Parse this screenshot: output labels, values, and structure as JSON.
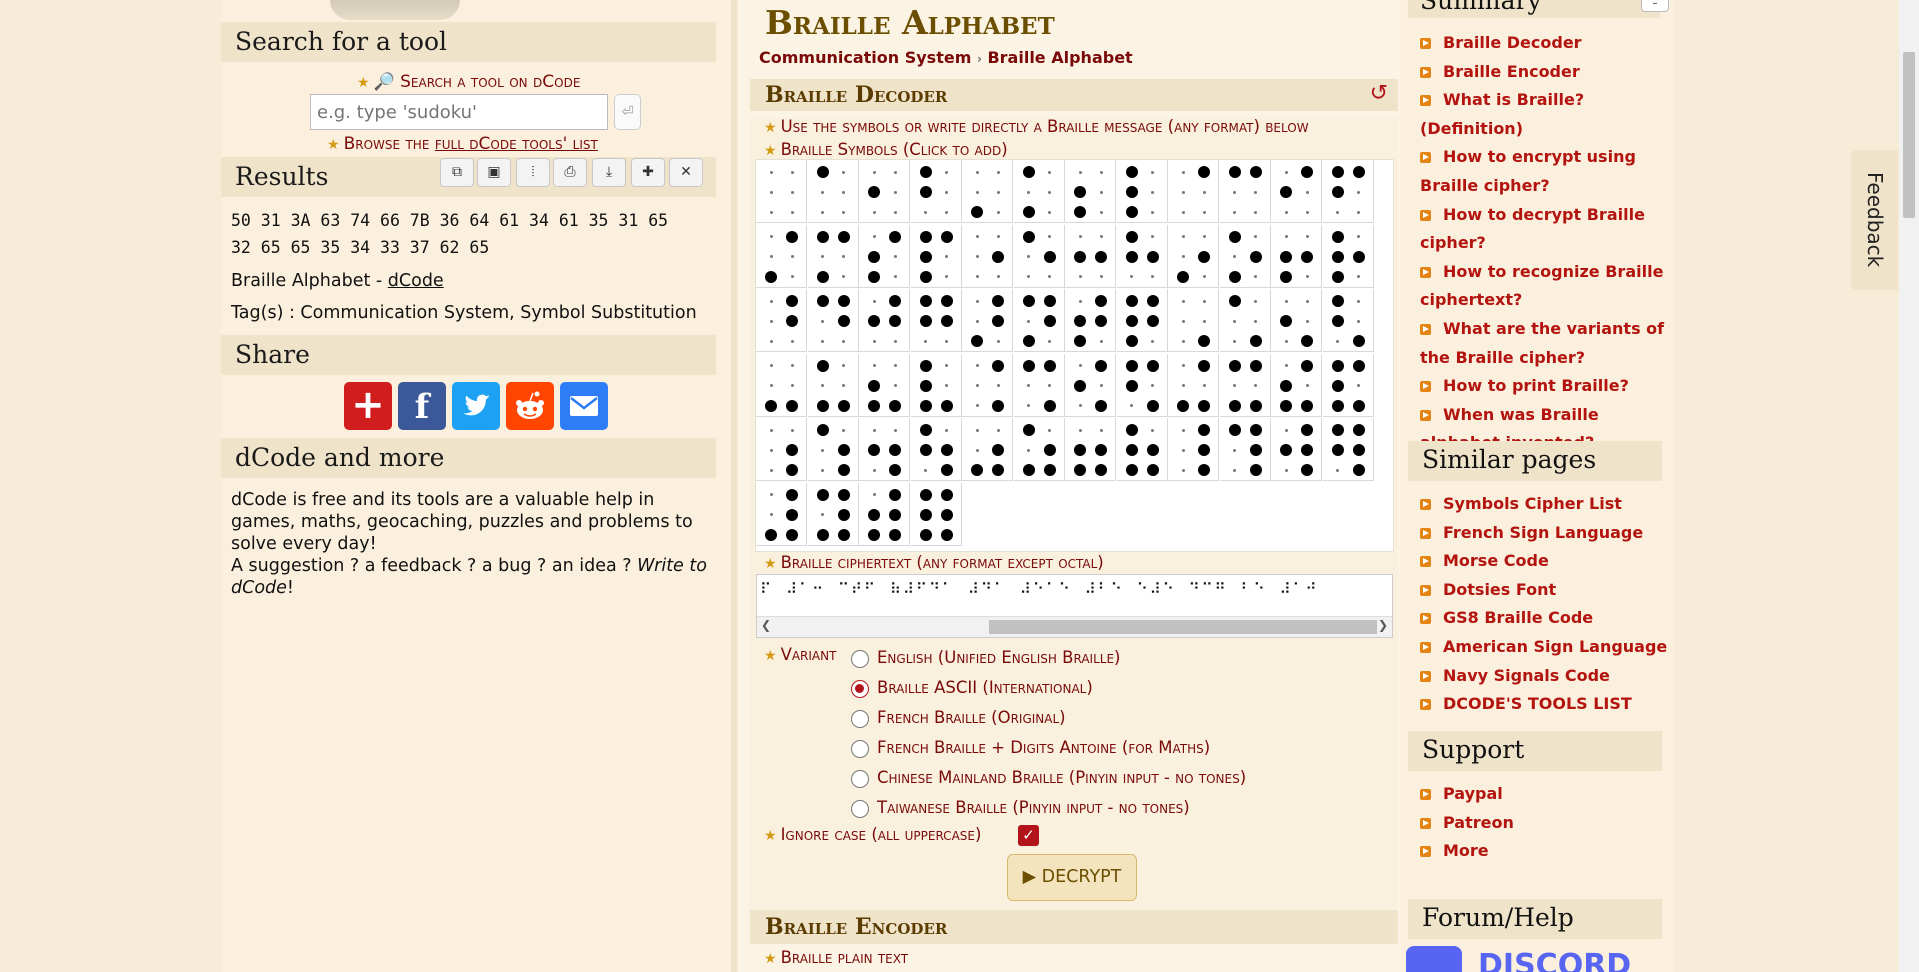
{
  "left": {
    "search_heading": "Search for a tool",
    "search_link": "Search a tool on dCode",
    "search_placeholder": "e.g. type 'sudoku'",
    "browse_prefix": "Browse the ",
    "browse_link": "full dCode tools' list",
    "results_heading": "Results",
    "results_line1": "50 31 3A 63 74 66 7B 36 64 61 34 61 35 31 65",
    "results_line2": "32 65 65 35 34 33 37 62 65",
    "page_ref": "Braille Alphabet - ",
    "page_ref_link": "dCode",
    "tags": "Tag(s) : Communication System, Symbol Substitution",
    "share_heading": "Share",
    "more_heading": "dCode and more",
    "more_text": "dCode is free and its tools are a valuable help in games, maths, geocaching, puzzles and problems to solve every day!",
    "more_text2": "A suggestion ? a feedback ? a bug ? an idea ? ",
    "more_text2_em": "Write to dCode",
    "more_text2_end": "!"
  },
  "main": {
    "title": "Braille Alphabet",
    "breadcrumb": [
      "Communication System",
      "Braille Alphabet"
    ],
    "decoder_heading": "Braille Decoder",
    "instruction": "Use the symbols or write directly a Braille message (any format) below",
    "symbols_label": "Braille Symbols (Click to add)",
    "ciphertext_label": "Braille ciphertext (any format except octal)",
    "ciphertext_value": "⠏⠀⠼⠁⠒⠀⠉⠞⠋⠀⠷⠼⠋⠙⠁⠀⠼⠙⠁⠀⠼⠑⠁⠑⠀⠼⠃⠑⠀⠑⠼⠑⠀⠙⠉⠛⠀⠃⠑⠀⠼⠁⠚",
    "variant_label": "Variant",
    "variants": [
      "English (Unified English Braille)",
      "Braille ASCII (International)",
      "French Braille (Original)",
      "French Braille + Digits Antoine (for Maths)",
      "Chinese Mainland Braille (Pinyin input - no tones)",
      "Taiwanese Braille (Pinyin input - no tones)"
    ],
    "selected_variant": 1,
    "ignore_case_label": "Ignore case (all uppercase)",
    "ignore_case_checked": true,
    "decrypt_label": "▶ DECRYPT",
    "encoder_heading": "Braille Encoder",
    "plain_label": "Braille plain text"
  },
  "right": {
    "summary_heading": "Summary",
    "summary_items": [
      "Braille Decoder",
      "Braille Encoder",
      "What is Braille? (Definition)",
      "How to encrypt using Braille cipher?",
      "How to decrypt Braille cipher?",
      "How to recognize Braille ciphertext?",
      "What are the variants of the Braille cipher?",
      "How to print Braille?",
      "When was Braille alphabet invented?"
    ],
    "similar_heading": "Similar pages",
    "similar_items": [
      "Symbols Cipher List",
      "French Sign Language",
      "Morse Code",
      "Dotsies Font",
      "GS8 Braille Code",
      "American Sign Language",
      "Navy Signals Code",
      "DCODE'S TOOLS LIST"
    ],
    "support_heading": "Support",
    "support_items": [
      "Paypal",
      "Patreon",
      "More"
    ],
    "forum_heading": "Forum/Help",
    "discord_text": "DISCORD"
  },
  "feedback_tab": "Feedback",
  "colors": {
    "accent_red": "#7a0a0a",
    "link_red": "#b4140f",
    "title_gold": "#6b4e00",
    "bullet_orange": "#e48413",
    "page_bg": "#f7ecd7"
  }
}
